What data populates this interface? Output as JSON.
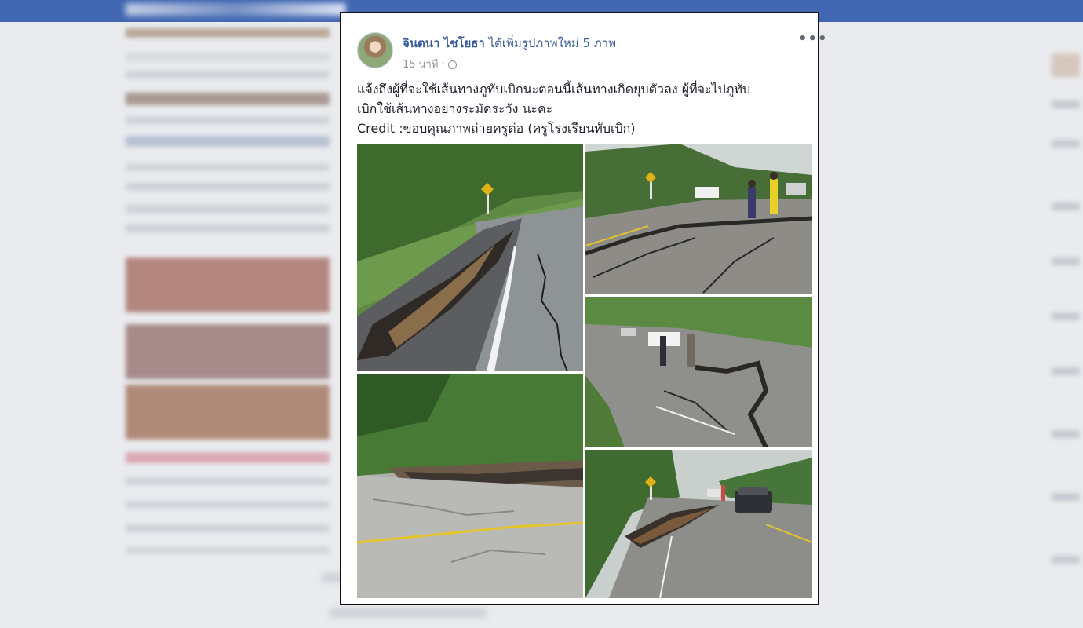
{
  "post": {
    "author": "จินตนา ไชโยธา",
    "action": "ได้เพิ่มรูปภาพใหม่ 5 ภาพ",
    "time": "15 นาที",
    "separator": "·",
    "more_label": "•••",
    "text_lines": [
      "แจ้งถึงผู้ที่จะใช้เส้นทางภูทับเบิกนะตอนนี้เส้นทางเกิดยุบตัวลง ผู้ที่จะไปภูทับ",
      "เบิกใช้เส้นทางอย่างระมัดระวัง นะคะ",
      "Credit :ขอบคุณภาพถ่ายครูต่อ (ครูโรงเรียนทับเบิก)"
    ]
  },
  "icons": [
    "avatar",
    "globe-icon",
    "more-options-icon"
  ],
  "colors": {
    "facebook_blue": "#4267b2",
    "link_blue": "#365899",
    "text": "#1d2129",
    "meta_gray": "#90949c",
    "background": "#e9ebee"
  }
}
